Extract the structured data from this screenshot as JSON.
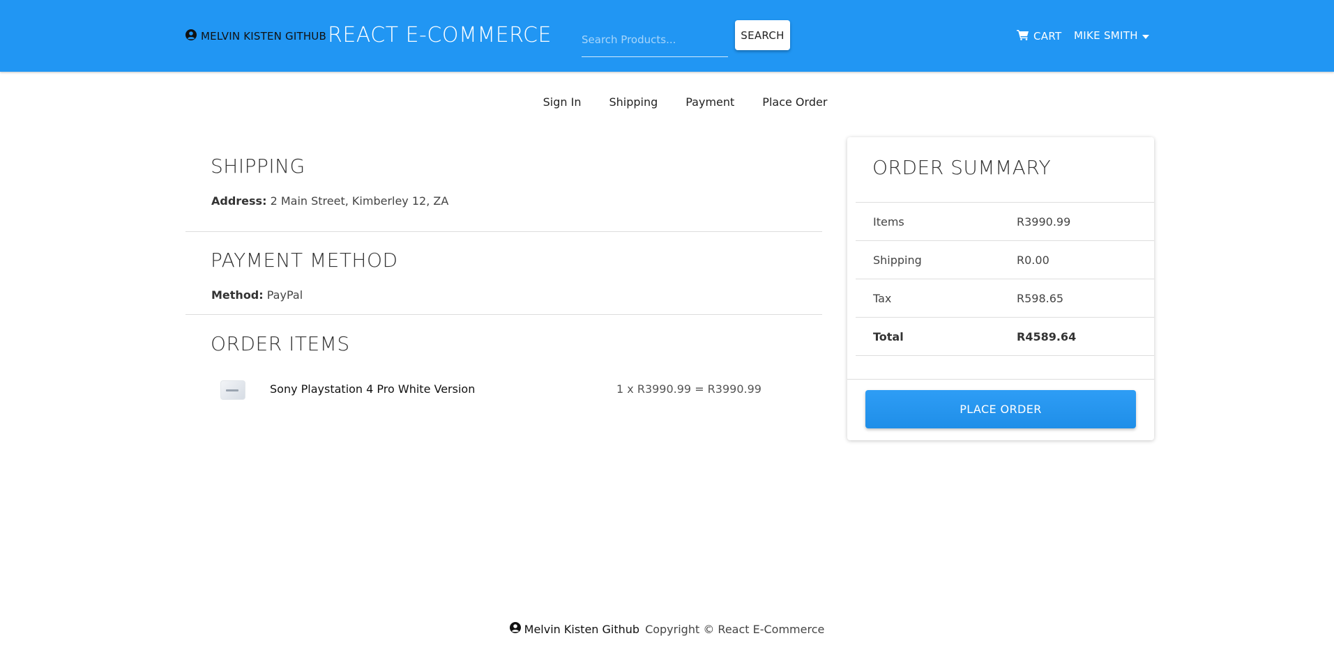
{
  "navbar": {
    "github_label": "MELVIN KISTEN GITHUB",
    "brand": "REACT E-COMMERCE",
    "search_placeholder": "Search Products...",
    "search_button": "SEARCH",
    "cart_label": "CART",
    "user_name": "MIKE SMITH",
    "icons": {
      "github": "user-circle-icon",
      "cart": "shopping-cart-icon",
      "user_menu": "caret-down-icon"
    },
    "colors": {
      "navbar_bg": "#2196f3"
    }
  },
  "steps": [
    "Sign In",
    "Shipping",
    "Payment",
    "Place Order"
  ],
  "shipping": {
    "title": "SHIPPING",
    "address_label": "Address:",
    "address_value": "2 Main Street, Kimberley 12, ZA"
  },
  "payment": {
    "title": "PAYMENT METHOD",
    "method_label": "Method:",
    "method_value": "PayPal"
  },
  "order_items": {
    "title": "ORDER ITEMS",
    "items": [
      {
        "name": "Sony Playstation 4 Pro White Version",
        "price_line": "1 x R3990.99 = R3990.99"
      }
    ]
  },
  "summary": {
    "title": "ORDER SUMMARY",
    "rows": [
      {
        "label": "Items",
        "value": "R3990.99"
      },
      {
        "label": "Shipping",
        "value": "R0.00"
      },
      {
        "label": "Tax",
        "value": "R598.65"
      },
      {
        "label": "Total",
        "value": "R4589.64"
      }
    ],
    "place_order_button": "PLACE ORDER"
  },
  "footer": {
    "github_label": "Melvin Kisten Github",
    "copyright": "Copyright © React E-Commerce"
  }
}
